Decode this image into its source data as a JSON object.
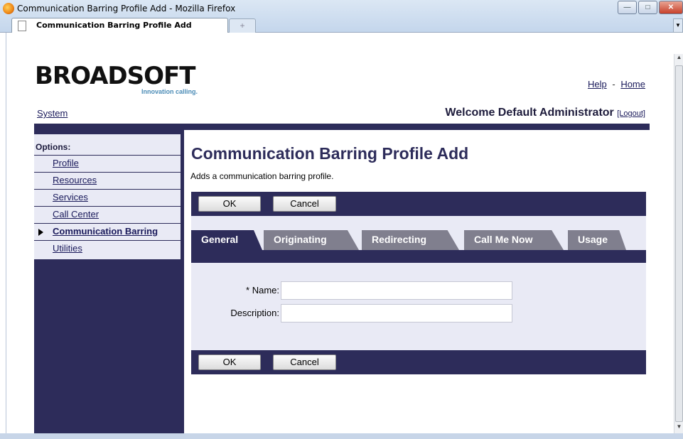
{
  "window": {
    "title": "Communication Barring Profile Add - Mozilla Firefox"
  },
  "browser": {
    "tab_label": "Communication Barring Profile Add",
    "new_tab_symbol": "+"
  },
  "header": {
    "logo_text": "BROADSOFT",
    "tagline": "Innovation calling.",
    "help_link": "Help",
    "separator": "-",
    "home_link": "Home",
    "system_link": "System",
    "welcome": "Welcome Default Administrator",
    "logout": "[Logout]"
  },
  "sidebar": {
    "title": "Options:",
    "items": [
      {
        "label": "Profile"
      },
      {
        "label": "Resources"
      },
      {
        "label": "Services"
      },
      {
        "label": "Call Center"
      },
      {
        "label": "Communication Barring",
        "active": true
      },
      {
        "label": "Utilities"
      }
    ]
  },
  "main": {
    "title": "Communication Barring Profile Add",
    "description": "Adds a communication barring profile.",
    "ok_label": "OK",
    "cancel_label": "Cancel",
    "tabs": [
      {
        "label": "General",
        "active": true
      },
      {
        "label": "Originating"
      },
      {
        "label": "Redirecting"
      },
      {
        "label": "Call Me Now"
      },
      {
        "label": "Usage"
      }
    ],
    "form": {
      "name_label": "* Name:",
      "name_value": "",
      "description_label": "Description:",
      "description_value": ""
    }
  },
  "colors": {
    "navy": "#2d2c5a",
    "panel": "#e9eaf5",
    "inactive_tab": "#807f8e"
  }
}
